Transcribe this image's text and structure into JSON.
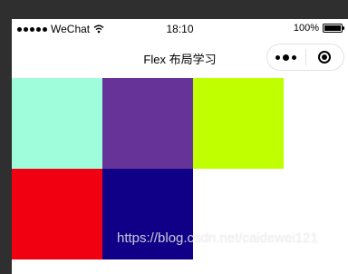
{
  "status_bar": {
    "carrier": "WeChat",
    "time": "18:10",
    "battery": "100%"
  },
  "nav": {
    "title": "Flex 布局学习"
  },
  "icons": {
    "signal": "signal-dots-icon",
    "wifi": "wifi-icon",
    "battery": "battery-icon",
    "more": "more-dots-icon",
    "close": "target-close-icon"
  },
  "boxes": [
    {
      "color": "#9ffddb"
    },
    {
      "color": "#663399"
    },
    {
      "color": "#bfff00"
    },
    {
      "color": "#f00010"
    },
    {
      "color": "#0f0087"
    }
  ],
  "watermark": "https://blog.csdn.net/caidewei121"
}
